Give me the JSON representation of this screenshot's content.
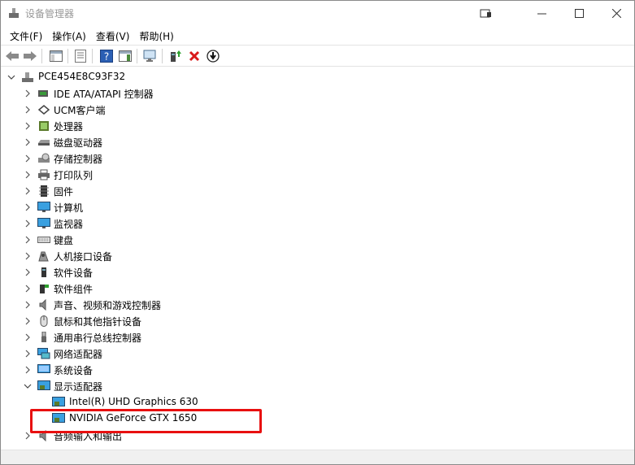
{
  "window": {
    "title": "设备管理器"
  },
  "menu": {
    "items": [
      "文件(F)",
      "操作(A)",
      "查看(V)",
      "帮助(H)"
    ]
  },
  "tree": {
    "root": "PCE454E8C93F32",
    "categories": [
      {
        "label": "IDE ATA/ATAPI 控制器",
        "icon": "ide-controller-icon"
      },
      {
        "label": "UCM客户端",
        "icon": "ucm-client-icon"
      },
      {
        "label": "处理器",
        "icon": "processor-icon"
      },
      {
        "label": "磁盘驱动器",
        "icon": "disk-drive-icon"
      },
      {
        "label": "存储控制器",
        "icon": "storage-controller-icon"
      },
      {
        "label": "打印队列",
        "icon": "printer-icon"
      },
      {
        "label": "固件",
        "icon": "firmware-icon"
      },
      {
        "label": "计算机",
        "icon": "computer-icon"
      },
      {
        "label": "监视器",
        "icon": "monitor-icon"
      },
      {
        "label": "键盘",
        "icon": "keyboard-icon"
      },
      {
        "label": "人机接口设备",
        "icon": "hid-icon"
      },
      {
        "label": "软件设备",
        "icon": "software-device-icon"
      },
      {
        "label": "软件组件",
        "icon": "software-component-icon"
      },
      {
        "label": "声音、视频和游戏控制器",
        "icon": "sound-icon"
      },
      {
        "label": "鼠标和其他指针设备",
        "icon": "mouse-icon"
      },
      {
        "label": "通用串行总线控制器",
        "icon": "usb-icon"
      },
      {
        "label": "网络适配器",
        "icon": "network-icon"
      },
      {
        "label": "系统设备",
        "icon": "system-device-icon"
      },
      {
        "label": "显示适配器",
        "icon": "display-adapter-icon"
      }
    ],
    "display_children": [
      "Intel(R) UHD Graphics 630",
      "NVIDIA GeForce GTX 1650"
    ],
    "last_partial": "音频输入和输出"
  },
  "colors": {
    "highlight": "#e81010",
    "accent_blue": "#1e6fd0"
  }
}
